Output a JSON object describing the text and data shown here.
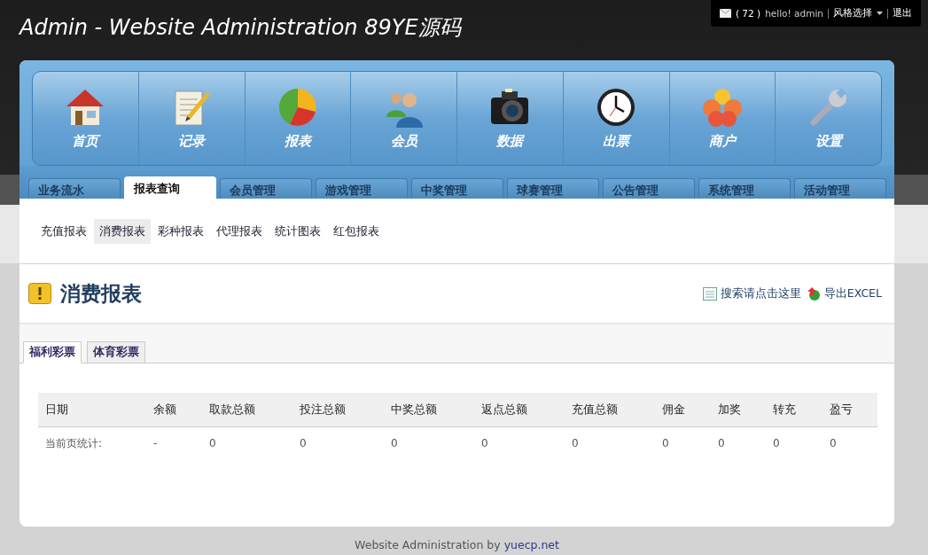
{
  "header": {
    "title": "Admin - Website Administration 89YE源码"
  },
  "user_bar": {
    "message_count": "( 72 )",
    "greeting": "hello! admin",
    "style_menu": "风格选择",
    "logout": "退出"
  },
  "nav": [
    {
      "label": "首页",
      "kind": "house"
    },
    {
      "label": "记录",
      "kind": "notepad"
    },
    {
      "label": "报表",
      "kind": "pie"
    },
    {
      "label": "会员",
      "kind": "people"
    },
    {
      "label": "数据",
      "kind": "camera"
    },
    {
      "label": "出票",
      "kind": "clock"
    },
    {
      "label": "商户",
      "kind": "shop"
    },
    {
      "label": "设置",
      "kind": "wrench"
    }
  ],
  "tabs": [
    {
      "label": "业务流水",
      "selected": false
    },
    {
      "label": "报表查询",
      "selected": true
    },
    {
      "label": "会员管理",
      "selected": false
    },
    {
      "label": "游戏管理",
      "selected": false
    },
    {
      "label": "中奖管理",
      "selected": false
    },
    {
      "label": "球赛管理",
      "selected": false
    },
    {
      "label": "公告管理",
      "selected": false
    },
    {
      "label": "系统管理",
      "selected": false
    },
    {
      "label": "活动管理",
      "selected": false
    }
  ],
  "subnav": [
    {
      "label": "充值报表",
      "selected": false
    },
    {
      "label": "消费报表",
      "selected": true
    },
    {
      "label": "彩种报表",
      "selected": false
    },
    {
      "label": "代理报表",
      "selected": false
    },
    {
      "label": "统计图表",
      "selected": false
    },
    {
      "label": "红包报表",
      "selected": false
    }
  ],
  "page": {
    "title": "消费报表",
    "search_link": "搜索请点击这里",
    "export_link": "导出EXCEL"
  },
  "lottery_tabs": [
    {
      "label": "福利彩票",
      "selected": true
    },
    {
      "label": "体育彩票",
      "selected": false
    }
  ],
  "table": {
    "columns": [
      "日期",
      "余额",
      "取款总额",
      "投注总额",
      "中奖总额",
      "返点总额",
      "充值总额",
      "佣金",
      "加奖",
      "转充",
      "盈亏"
    ],
    "rows": [
      [
        "当前页统计:",
        "-",
        "0",
        "0",
        "0",
        "0",
        "0",
        "0",
        "0",
        "0",
        "0"
      ]
    ]
  },
  "footer": {
    "text": "Website Administration by",
    "link": "yuecp.net"
  }
}
